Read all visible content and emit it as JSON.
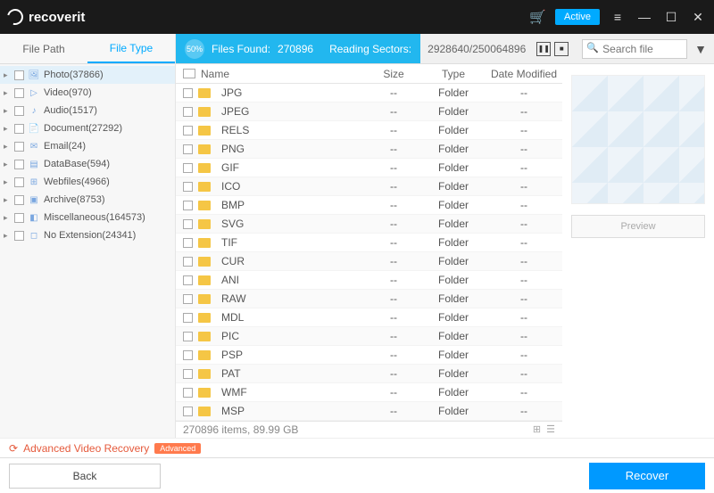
{
  "app": {
    "name": "recoverit",
    "active_label": "Active"
  },
  "sidebar": {
    "tabs": [
      {
        "label": "File Path"
      },
      {
        "label": "File Type"
      }
    ],
    "items": [
      {
        "label": "Photo(37866)",
        "icon": "🖼",
        "active": true
      },
      {
        "label": "Video(970)",
        "icon": "▷"
      },
      {
        "label": "Audio(1517)",
        "icon": "♪"
      },
      {
        "label": "Document(27292)",
        "icon": "📄"
      },
      {
        "label": "Email(24)",
        "icon": "✉"
      },
      {
        "label": "DataBase(594)",
        "icon": "▤"
      },
      {
        "label": "Webfiles(4966)",
        "icon": "⊞"
      },
      {
        "label": "Archive(8753)",
        "icon": "▣"
      },
      {
        "label": "Miscellaneous(164573)",
        "icon": "◧"
      },
      {
        "label": "No Extension(24341)",
        "icon": "◻"
      }
    ]
  },
  "status": {
    "progress": "50%",
    "files_found_label": "Files Found:",
    "files_found": "270896",
    "reading_label": "Reading Sectors:",
    "sectors": "2928640/250064896",
    "search_placeholder": "Search file"
  },
  "table": {
    "headers": {
      "name": "Name",
      "size": "Size",
      "type": "Type",
      "modified": "Date Modified"
    },
    "rows": [
      {
        "name": "JPG",
        "size": "--",
        "type": "Folder",
        "modified": "--"
      },
      {
        "name": "JPEG",
        "size": "--",
        "type": "Folder",
        "modified": "--"
      },
      {
        "name": "RELS",
        "size": "--",
        "type": "Folder",
        "modified": "--"
      },
      {
        "name": "PNG",
        "size": "--",
        "type": "Folder",
        "modified": "--"
      },
      {
        "name": "GIF",
        "size": "--",
        "type": "Folder",
        "modified": "--"
      },
      {
        "name": "ICO",
        "size": "--",
        "type": "Folder",
        "modified": "--"
      },
      {
        "name": "BMP",
        "size": "--",
        "type": "Folder",
        "modified": "--"
      },
      {
        "name": "SVG",
        "size": "--",
        "type": "Folder",
        "modified": "--"
      },
      {
        "name": "TIF",
        "size": "--",
        "type": "Folder",
        "modified": "--"
      },
      {
        "name": "CUR",
        "size": "--",
        "type": "Folder",
        "modified": "--"
      },
      {
        "name": "ANI",
        "size": "--",
        "type": "Folder",
        "modified": "--"
      },
      {
        "name": "RAW",
        "size": "--",
        "type": "Folder",
        "modified": "--"
      },
      {
        "name": "MDL",
        "size": "--",
        "type": "Folder",
        "modified": "--"
      },
      {
        "name": "PIC",
        "size": "--",
        "type": "Folder",
        "modified": "--"
      },
      {
        "name": "PSP",
        "size": "--",
        "type": "Folder",
        "modified": "--"
      },
      {
        "name": "PAT",
        "size": "--",
        "type": "Folder",
        "modified": "--"
      },
      {
        "name": "WMF",
        "size": "--",
        "type": "Folder",
        "modified": "--"
      },
      {
        "name": "MSP",
        "size": "--",
        "type": "Folder",
        "modified": "--"
      }
    ],
    "summary": "270896 items, 89.99  GB"
  },
  "preview_label": "Preview",
  "advanced_label": "Advanced Video Recovery",
  "advanced_badge": "Advanced",
  "footer": {
    "back": "Back",
    "recover": "Recover"
  }
}
